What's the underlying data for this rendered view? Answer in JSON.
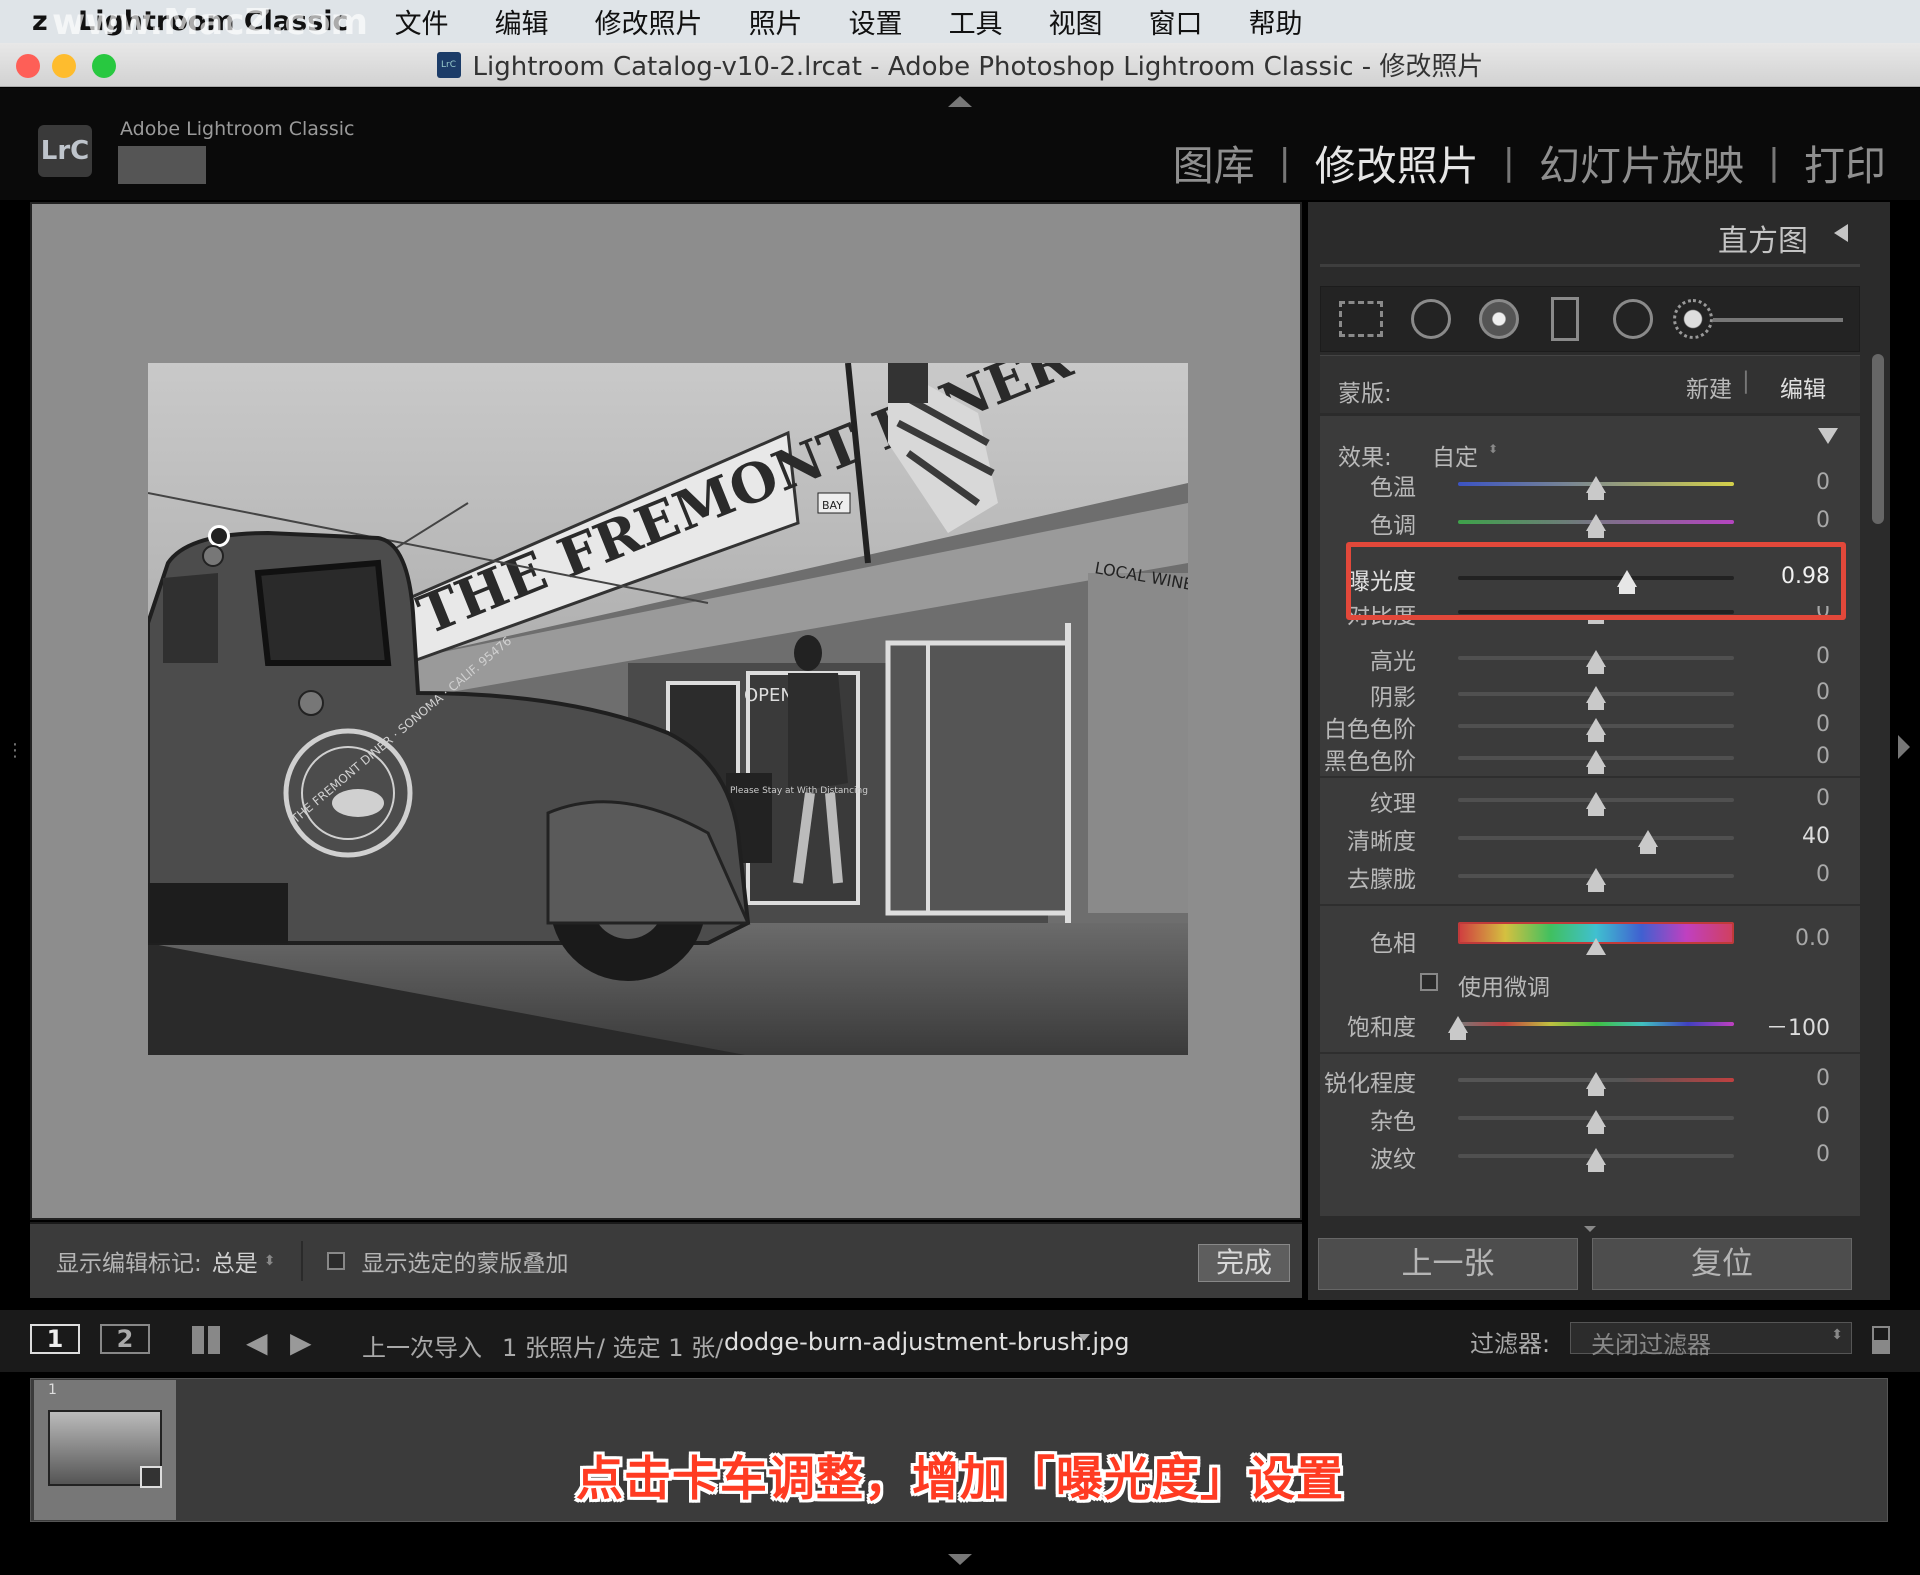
{
  "menubar": {
    "apple": "z",
    "app": "Lightroom Classic",
    "items": [
      "文件",
      "编辑",
      "修改照片",
      "照片",
      "设置",
      "工具",
      "视图",
      "窗口",
      "帮助"
    ]
  },
  "window": {
    "title": "Lightroom Catalog-v10-2.lrcat - Adobe Photoshop Lightroom Classic - 修改照片",
    "doc_icon": "LrC"
  },
  "lr": {
    "logo": "LrC",
    "brand": "Adobe Lightroom Classic"
  },
  "modules": {
    "library": "图库",
    "develop": "修改照片",
    "slideshow": "幻灯片放映",
    "print": "打印",
    "active": "修改照片"
  },
  "histogram": {
    "title": "直方图"
  },
  "mask": {
    "label": "蒙版:",
    "new": "新建",
    "edit": "编辑"
  },
  "effect": {
    "label": "效果:",
    "preset": "自定"
  },
  "sliders": {
    "temp": {
      "label": "色温",
      "value": "0"
    },
    "tint": {
      "label": "色调",
      "value": "0"
    },
    "exposure": {
      "label": "曝光度",
      "value": "0.98"
    },
    "contrast": {
      "label": "对比度",
      "value": "0"
    },
    "highlights": {
      "label": "高光",
      "value": "0"
    },
    "shadows": {
      "label": "阴影",
      "value": "0"
    },
    "whites": {
      "label": "白色色阶",
      "value": "0"
    },
    "blacks": {
      "label": "黑色色阶",
      "value": "0"
    },
    "texture": {
      "label": "纹理",
      "value": "0"
    },
    "clarity": {
      "label": "清晰度",
      "value": "40"
    },
    "dehaze": {
      "label": "去朦胧",
      "value": "0"
    },
    "hue": {
      "label": "色相",
      "value": "0.0"
    },
    "finetune": {
      "label": "使用微调"
    },
    "saturation": {
      "label": "饱和度",
      "value": "－100"
    },
    "sharpness": {
      "label": "锐化程度",
      "value": "0"
    },
    "noise": {
      "label": "杂色",
      "value": "0"
    },
    "moire": {
      "label": "波纹",
      "value": "0"
    }
  },
  "buttons": {
    "prev": "上一张",
    "reset": "复位",
    "done": "完成"
  },
  "toolbar": {
    "show_pins_label": "显示编辑标记:",
    "show_pins_value": "总是",
    "overlay": "显示选定的蒙版叠加"
  },
  "filmstrip": {
    "view1": "1",
    "view2": "2",
    "source": "上一次导入",
    "count": "1 张照片/ 选定 1 张/",
    "filename": "dodge-burn-adjustment-brush.jpg",
    "filter_label": "过滤器:",
    "filter_value": "关闭过滤器",
    "thumb_index": "1"
  },
  "photo": {
    "sign_main": "THE FREMONT DINER",
    "sign_wine": "LOCAL WINE",
    "sign_bay": "BAY",
    "door_logo": "THE FREMONT DINER · SONOMA · CALIF. 95476",
    "chalkboard": "Please Stay at With Distancing",
    "open": "OPEN"
  },
  "caption": "点击卡车调整，增加「曝光度」设置",
  "watermark": "www.MacZ.com"
}
